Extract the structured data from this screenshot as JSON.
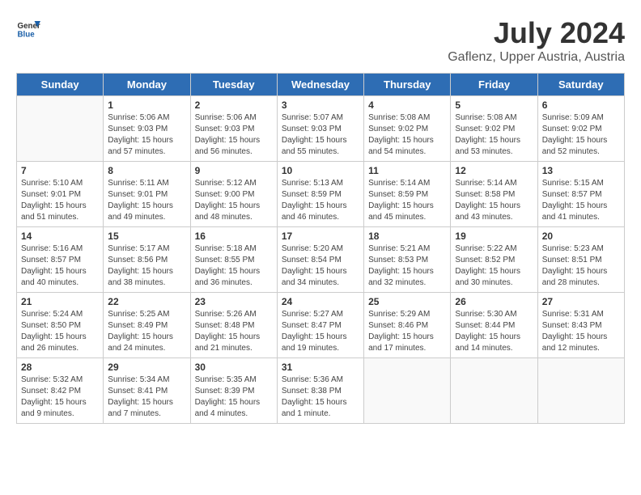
{
  "header": {
    "logo_line1": "General",
    "logo_line2": "Blue",
    "month": "July 2024",
    "location": "Gaflenz, Upper Austria, Austria"
  },
  "weekdays": [
    "Sunday",
    "Monday",
    "Tuesday",
    "Wednesday",
    "Thursday",
    "Friday",
    "Saturday"
  ],
  "weeks": [
    [
      {
        "day": "",
        "content": ""
      },
      {
        "day": "1",
        "content": "Sunrise: 5:06 AM\nSunset: 9:03 PM\nDaylight: 15 hours\nand 57 minutes."
      },
      {
        "day": "2",
        "content": "Sunrise: 5:06 AM\nSunset: 9:03 PM\nDaylight: 15 hours\nand 56 minutes."
      },
      {
        "day": "3",
        "content": "Sunrise: 5:07 AM\nSunset: 9:03 PM\nDaylight: 15 hours\nand 55 minutes."
      },
      {
        "day": "4",
        "content": "Sunrise: 5:08 AM\nSunset: 9:02 PM\nDaylight: 15 hours\nand 54 minutes."
      },
      {
        "day": "5",
        "content": "Sunrise: 5:08 AM\nSunset: 9:02 PM\nDaylight: 15 hours\nand 53 minutes."
      },
      {
        "day": "6",
        "content": "Sunrise: 5:09 AM\nSunset: 9:02 PM\nDaylight: 15 hours\nand 52 minutes."
      }
    ],
    [
      {
        "day": "7",
        "content": "Sunrise: 5:10 AM\nSunset: 9:01 PM\nDaylight: 15 hours\nand 51 minutes."
      },
      {
        "day": "8",
        "content": "Sunrise: 5:11 AM\nSunset: 9:01 PM\nDaylight: 15 hours\nand 49 minutes."
      },
      {
        "day": "9",
        "content": "Sunrise: 5:12 AM\nSunset: 9:00 PM\nDaylight: 15 hours\nand 48 minutes."
      },
      {
        "day": "10",
        "content": "Sunrise: 5:13 AM\nSunset: 8:59 PM\nDaylight: 15 hours\nand 46 minutes."
      },
      {
        "day": "11",
        "content": "Sunrise: 5:14 AM\nSunset: 8:59 PM\nDaylight: 15 hours\nand 45 minutes."
      },
      {
        "day": "12",
        "content": "Sunrise: 5:14 AM\nSunset: 8:58 PM\nDaylight: 15 hours\nand 43 minutes."
      },
      {
        "day": "13",
        "content": "Sunrise: 5:15 AM\nSunset: 8:57 PM\nDaylight: 15 hours\nand 41 minutes."
      }
    ],
    [
      {
        "day": "14",
        "content": "Sunrise: 5:16 AM\nSunset: 8:57 PM\nDaylight: 15 hours\nand 40 minutes."
      },
      {
        "day": "15",
        "content": "Sunrise: 5:17 AM\nSunset: 8:56 PM\nDaylight: 15 hours\nand 38 minutes."
      },
      {
        "day": "16",
        "content": "Sunrise: 5:18 AM\nSunset: 8:55 PM\nDaylight: 15 hours\nand 36 minutes."
      },
      {
        "day": "17",
        "content": "Sunrise: 5:20 AM\nSunset: 8:54 PM\nDaylight: 15 hours\nand 34 minutes."
      },
      {
        "day": "18",
        "content": "Sunrise: 5:21 AM\nSunset: 8:53 PM\nDaylight: 15 hours\nand 32 minutes."
      },
      {
        "day": "19",
        "content": "Sunrise: 5:22 AM\nSunset: 8:52 PM\nDaylight: 15 hours\nand 30 minutes."
      },
      {
        "day": "20",
        "content": "Sunrise: 5:23 AM\nSunset: 8:51 PM\nDaylight: 15 hours\nand 28 minutes."
      }
    ],
    [
      {
        "day": "21",
        "content": "Sunrise: 5:24 AM\nSunset: 8:50 PM\nDaylight: 15 hours\nand 26 minutes."
      },
      {
        "day": "22",
        "content": "Sunrise: 5:25 AM\nSunset: 8:49 PM\nDaylight: 15 hours\nand 24 minutes."
      },
      {
        "day": "23",
        "content": "Sunrise: 5:26 AM\nSunset: 8:48 PM\nDaylight: 15 hours\nand 21 minutes."
      },
      {
        "day": "24",
        "content": "Sunrise: 5:27 AM\nSunset: 8:47 PM\nDaylight: 15 hours\nand 19 minutes."
      },
      {
        "day": "25",
        "content": "Sunrise: 5:29 AM\nSunset: 8:46 PM\nDaylight: 15 hours\nand 17 minutes."
      },
      {
        "day": "26",
        "content": "Sunrise: 5:30 AM\nSunset: 8:44 PM\nDaylight: 15 hours\nand 14 minutes."
      },
      {
        "day": "27",
        "content": "Sunrise: 5:31 AM\nSunset: 8:43 PM\nDaylight: 15 hours\nand 12 minutes."
      }
    ],
    [
      {
        "day": "28",
        "content": "Sunrise: 5:32 AM\nSunset: 8:42 PM\nDaylight: 15 hours\nand 9 minutes."
      },
      {
        "day": "29",
        "content": "Sunrise: 5:34 AM\nSunset: 8:41 PM\nDaylight: 15 hours\nand 7 minutes."
      },
      {
        "day": "30",
        "content": "Sunrise: 5:35 AM\nSunset: 8:39 PM\nDaylight: 15 hours\nand 4 minutes."
      },
      {
        "day": "31",
        "content": "Sunrise: 5:36 AM\nSunset: 8:38 PM\nDaylight: 15 hours\nand 1 minute."
      },
      {
        "day": "",
        "content": ""
      },
      {
        "day": "",
        "content": ""
      },
      {
        "day": "",
        "content": ""
      }
    ]
  ]
}
